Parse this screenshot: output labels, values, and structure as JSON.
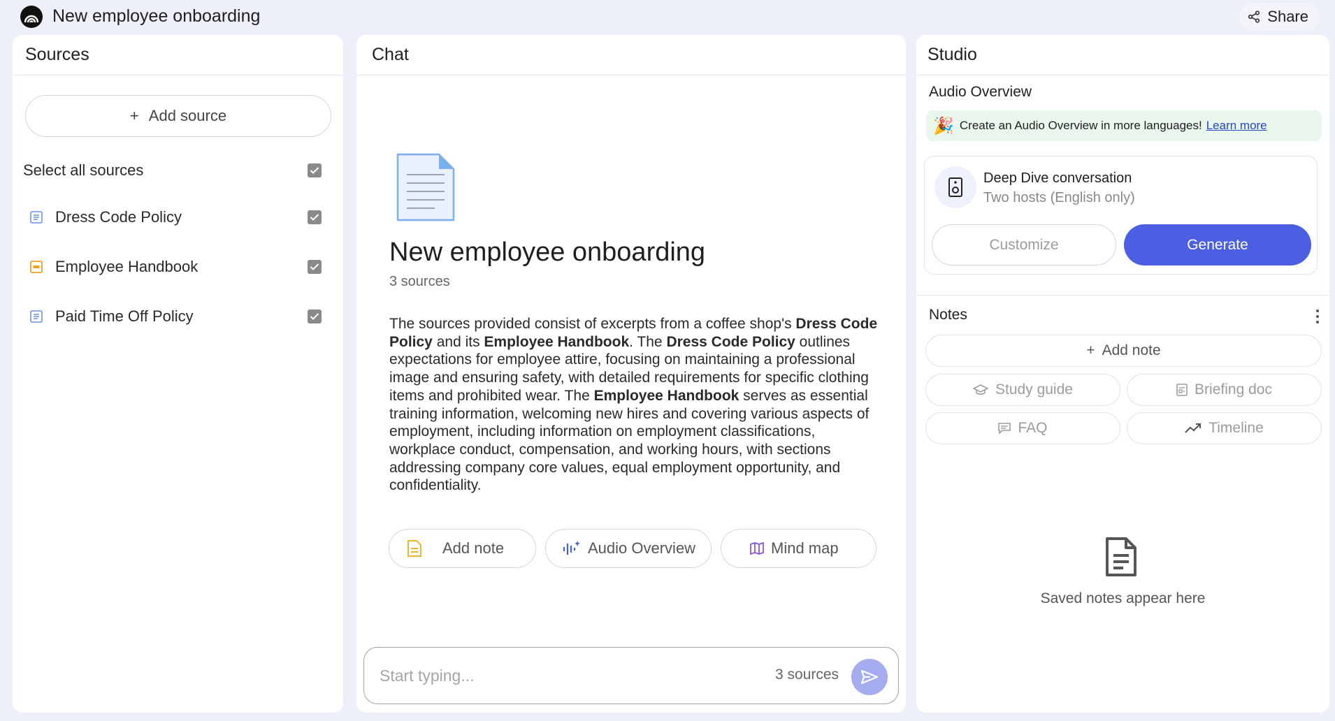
{
  "app": {
    "title": "New employee onboarding",
    "share_label": "Share"
  },
  "sources_panel": {
    "title": "Sources",
    "add_source_label": "Add source",
    "select_all_label": "Select all sources",
    "items": [
      {
        "label": "Dress Code Policy",
        "icon": "text-doc-icon",
        "color": "#6f8fe8"
      },
      {
        "label": "Employee Handbook",
        "icon": "handbook-doc-icon",
        "color": "#f0a020"
      },
      {
        "label": "Paid Time Off Policy",
        "icon": "text-doc-icon",
        "color": "#6f8fe8"
      }
    ]
  },
  "chat_panel": {
    "title": "Chat",
    "notebook_title": "New employee onboarding",
    "source_count": "3 sources",
    "summary": [
      {
        "text": "The sources provided consist of excerpts from a coffee shop's ",
        "bold": false
      },
      {
        "text": "Dress Code Policy",
        "bold": true
      },
      {
        "text": " and its ",
        "bold": false
      },
      {
        "text": "Employee Handbook",
        "bold": true
      },
      {
        "text": ". The ",
        "bold": false
      },
      {
        "text": "Dress Code Policy",
        "bold": true
      },
      {
        "text": " outlines expectations for employee attire, focusing on maintaining a professional image and ensuring safety, with detailed requirements for specific clothing items and prohibited wear. The ",
        "bold": false
      },
      {
        "text": "Employee Handbook",
        "bold": true
      },
      {
        "text": " serves as essential training information, welcoming new hires and covering various aspects of employment, including information on employment classifications, workplace conduct, compensation, and working hours, with sections addressing company core values, equal employment opportunity, and confidentiality.",
        "bold": false
      }
    ],
    "actions": {
      "add_note": "Add note",
      "audio_overview": "Audio Overview",
      "mind_map": "Mind map"
    },
    "input_placeholder": "Start typing...",
    "input_source_count": "3 sources"
  },
  "studio_panel": {
    "title": "Studio",
    "audio_overview_title": "Audio Overview",
    "banner_text": "Create an Audio Overview in more languages!",
    "banner_link": "Learn more",
    "deep_dive_title": "Deep Dive conversation",
    "deep_dive_sub": "Two hosts (English only)",
    "customize_label": "Customize",
    "generate_label": "Generate",
    "notes_title": "Notes",
    "add_note_label": "Add note",
    "study_guide_label": "Study guide",
    "briefing_doc_label": "Briefing doc",
    "faq_label": "FAQ",
    "timeline_label": "Timeline",
    "empty_text": "Saved notes appear here"
  },
  "colors": {
    "accent": "#4c5fe2",
    "background": "#eef0f9",
    "banner": "#e8f6ec",
    "link": "#2747c7"
  }
}
